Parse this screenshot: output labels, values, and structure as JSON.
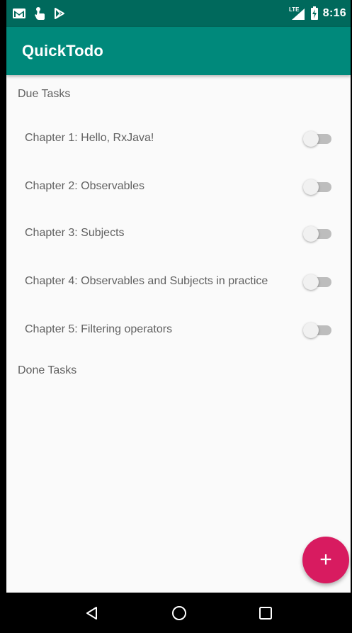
{
  "status_bar": {
    "time": "8:16",
    "network": "LTE",
    "icons": [
      "gmail-icon",
      "touch-icon",
      "play-store-icon",
      "signal-icon",
      "battery-charging-icon"
    ]
  },
  "app_bar": {
    "title": "QuickTodo",
    "color": "#00897b",
    "status_color": "#00695c"
  },
  "sections": {
    "due_header": "Due Tasks",
    "done_header": "Done Tasks"
  },
  "due_tasks": [
    {
      "title": "Chapter 1: Hello, RxJava!",
      "done": false
    },
    {
      "title": "Chapter 2: Observables",
      "done": false
    },
    {
      "title": "Chapter 3: Subjects",
      "done": false
    },
    {
      "title": "Chapter 4: Observables and Subjects in practice",
      "done": false
    },
    {
      "title": "Chapter 5: Filtering operators",
      "done": false
    }
  ],
  "fab": {
    "icon": "plus-icon",
    "label": "+",
    "color": "#d81b60"
  },
  "nav_bar": {
    "icons": [
      "back-icon",
      "home-icon",
      "recents-icon"
    ]
  }
}
